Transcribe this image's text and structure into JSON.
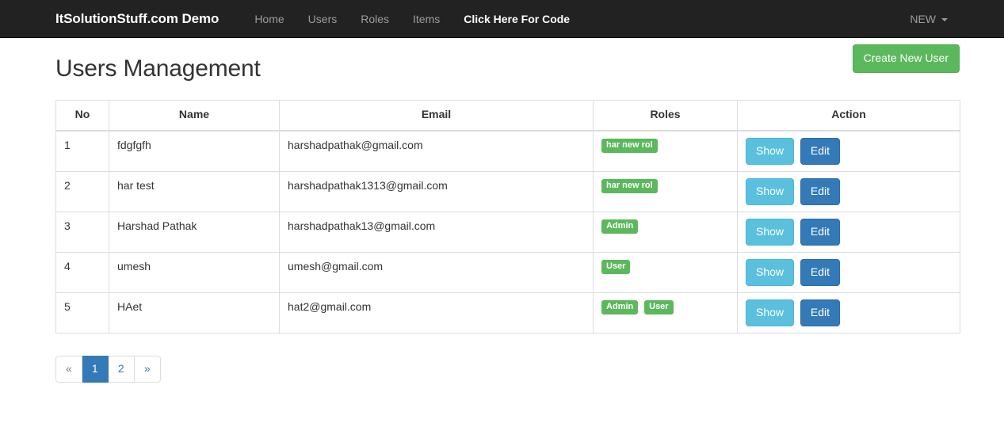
{
  "navbar": {
    "brand": "ItSolutionStuff.com Demo",
    "items": [
      {
        "label": "Home",
        "active": false
      },
      {
        "label": "Users",
        "active": false
      },
      {
        "label": "Roles",
        "active": false
      },
      {
        "label": "Items",
        "active": false
      },
      {
        "label": "Click Here For Code",
        "active": true
      }
    ],
    "right": {
      "label": "NEW",
      "caret_icon": "caret-down-icon"
    },
    "background_color": "#222222",
    "link_color": "#9d9d9d"
  },
  "page": {
    "title": "Users Management",
    "create_button": {
      "label": "Create New User",
      "color": "#5cb85c"
    }
  },
  "table": {
    "columns": [
      "No",
      "Name",
      "Email",
      "Roles",
      "Action"
    ],
    "rows": [
      {
        "no": "1",
        "name": "fdgfgfh",
        "email": "harshadpathak@gmail.com",
        "roles": [
          "har new rol"
        ],
        "actions": [
          "Show",
          "Edit"
        ]
      },
      {
        "no": "2",
        "name": "har test",
        "email": "harshadpathak1313@gmail.com",
        "roles": [
          "har new rol"
        ],
        "actions": [
          "Show",
          "Edit"
        ]
      },
      {
        "no": "3",
        "name": "Harshad Pathak",
        "email": "harshadpathak13@gmail.com",
        "roles": [
          "Admin"
        ],
        "actions": [
          "Show",
          "Edit"
        ]
      },
      {
        "no": "4",
        "name": "umesh",
        "email": "umesh@gmail.com",
        "roles": [
          "User"
        ],
        "actions": [
          "Show",
          "Edit"
        ]
      },
      {
        "no": "5",
        "name": "HAet",
        "email": "hat2@gmail.com",
        "roles": [
          "Admin",
          "User"
        ],
        "actions": [
          "Show",
          "Edit"
        ]
      }
    ],
    "badge_color": "#5cb85c",
    "show_button_color": "#5bc0de",
    "edit_button_color": "#337ab7"
  },
  "pagination": {
    "items": [
      {
        "label": "«",
        "state": "disabled"
      },
      {
        "label": "1",
        "state": "active"
      },
      {
        "label": "2",
        "state": "normal"
      },
      {
        "label": "»",
        "state": "normal"
      }
    ],
    "active_color": "#337ab7"
  }
}
